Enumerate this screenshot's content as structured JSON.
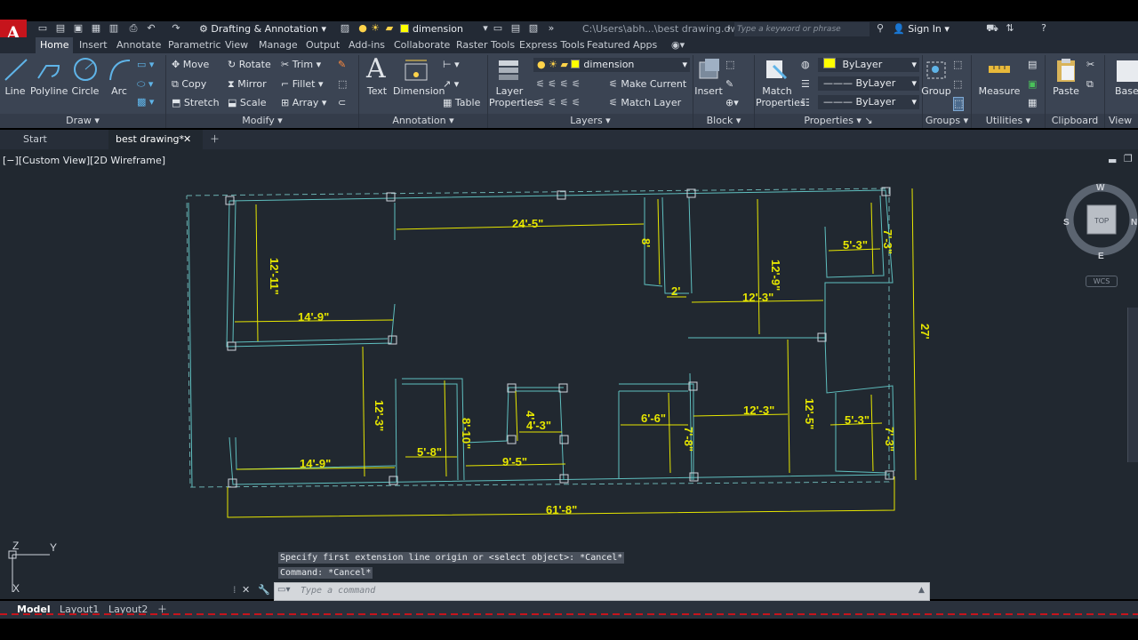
{
  "app": {
    "logo": "A",
    "workspace": "Drafting & Annotation",
    "file_path": "C:\\Users\\abh...\\best drawing.dwg",
    "search_placeholder": "Type a keyword or phrase",
    "sign_in": "Sign In",
    "quick_layer": "dimension"
  },
  "ribbon_tabs": [
    "Home",
    "Insert",
    "Annotate",
    "Parametric",
    "View",
    "Manage",
    "Output",
    "Add-ins",
    "Collaborate",
    "Raster Tools",
    "Express Tools",
    "Featured Apps"
  ],
  "ribbon": {
    "draw": {
      "title": "Draw",
      "line": "Line",
      "polyline": "Polyline",
      "circle": "Circle",
      "arc": "Arc"
    },
    "modify": {
      "title": "Modify",
      "move": "Move",
      "rotate": "Rotate",
      "trim": "Trim",
      "copy": "Copy",
      "mirror": "Mirror",
      "fillet": "Fillet",
      "stretch": "Stretch",
      "scale": "Scale",
      "array": "Array"
    },
    "annotation": {
      "title": "Annotation",
      "text": "Text",
      "dimension": "Dimension",
      "table": "Table"
    },
    "layers": {
      "title": "Layers",
      "layer_properties_1": "Layer",
      "layer_properties_2": "Properties",
      "current_layer": "dimension",
      "make_current": "Make Current",
      "match_layer": "Match Layer"
    },
    "block": {
      "title": "Block",
      "insert": "Insert"
    },
    "properties": {
      "title": "Properties",
      "match_1": "Match",
      "match_2": "Properties",
      "color": "ByLayer",
      "linetype": "ByLayer",
      "lineweight": "ByLayer"
    },
    "groups": {
      "title": "Groups",
      "group": "Group"
    },
    "utilities": {
      "title": "Utilities",
      "measure": "Measure"
    },
    "clipboard": {
      "title": "Clipboard",
      "paste": "Paste"
    },
    "view": {
      "title": "View",
      "base": "Base"
    }
  },
  "file_tabs": [
    "Start",
    "best drawing*"
  ],
  "viewport_label": "[−][Custom View][2D Wireframe]",
  "viewcube": {
    "top": "TOP",
    "north": "N",
    "south": "S",
    "east": "E",
    "west": "W",
    "wcs": "WCS"
  },
  "ucs": {
    "x": "X",
    "y": "Y",
    "z": "Z"
  },
  "dimensions": [
    "24'-5\"",
    "8'",
    "12'-9\"",
    "5'-3\"",
    "7'-3\"",
    "12'-11\"",
    "14'-9\"",
    "2'",
    "12'-3\"",
    "27'",
    "12'-3\"",
    "8'-10\"",
    "4'-3\"",
    "4'",
    "6'-6\"",
    "12'-3\"",
    "12'-5\"",
    "5'-3\"",
    "7'-3\"",
    "7'-8\"",
    "5'-8\"",
    "9'-5\"",
    "14'-9\"",
    "61'-8\""
  ],
  "command": {
    "history_1": "Specify first extension line origin or <select object>: *Cancel*",
    "history_2": "Command: *Cancel*",
    "placeholder": "Type a command"
  },
  "layout_tabs": [
    "Model",
    "Layout1",
    "Layout2"
  ],
  "colors": {
    "accent_red": "#c6141c",
    "wall_cyan": "#5fbfbf",
    "dim_yellow": "#e6e600",
    "canvas": "#212830",
    "ribbon": "#3b4453"
  }
}
